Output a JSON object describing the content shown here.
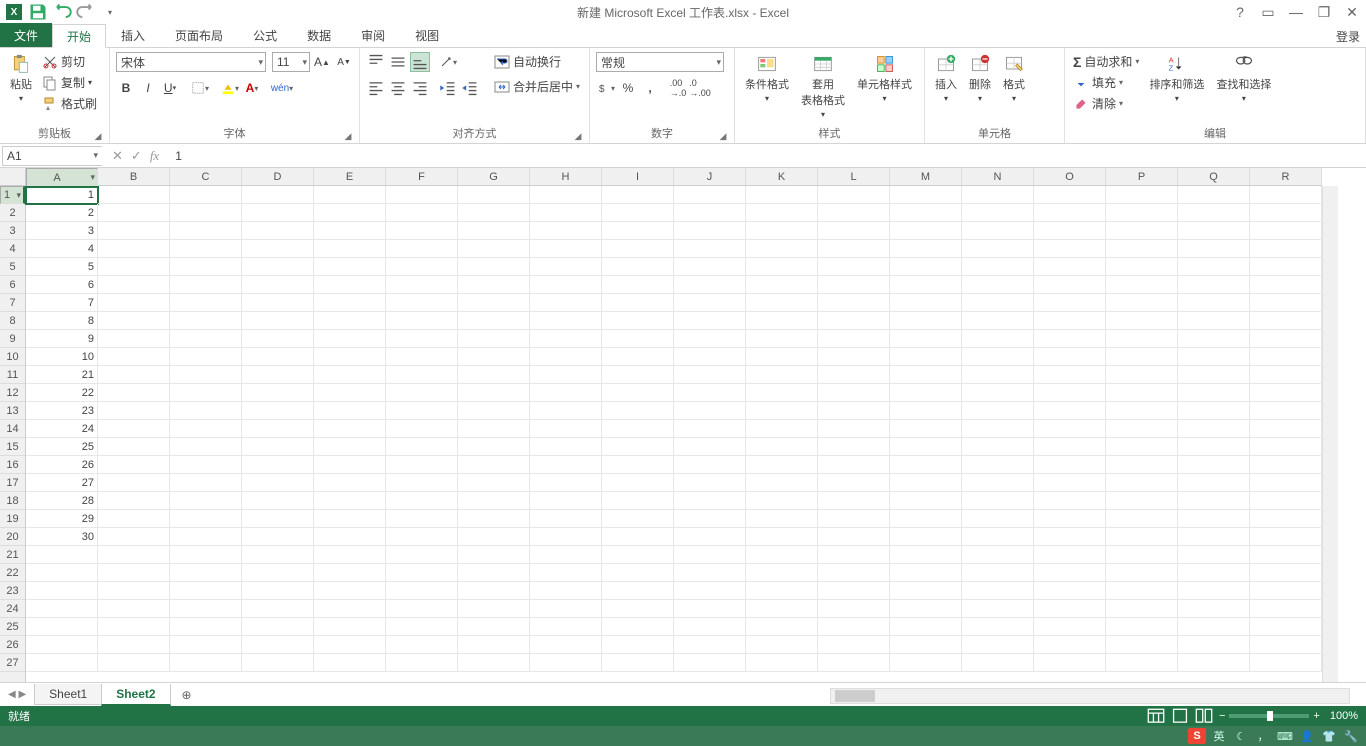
{
  "title": "新建 Microsoft Excel 工作表.xlsx - Excel",
  "login_label": "登录",
  "tabs": {
    "file": "文件",
    "home": "开始",
    "insert": "插入",
    "layout": "页面布局",
    "formulas": "公式",
    "data": "数据",
    "review": "审阅",
    "view": "视图"
  },
  "ribbon": {
    "clipboard": {
      "label": "剪贴板",
      "paste": "粘贴",
      "cut": "剪切",
      "copy": "复制",
      "format_painter": "格式刷"
    },
    "font": {
      "label": "字体",
      "name": "宋体",
      "size": "11"
    },
    "align": {
      "label": "对齐方式",
      "wrap": "自动换行",
      "merge": "合并后居中"
    },
    "number": {
      "label": "数字",
      "format": "常规"
    },
    "styles": {
      "label": "样式",
      "cond": "条件格式",
      "table": "套用\n表格格式",
      "cell": "单元格样式"
    },
    "cells": {
      "label": "单元格",
      "insert": "插入",
      "delete": "删除",
      "format": "格式"
    },
    "editing": {
      "label": "编辑",
      "sum": "自动求和",
      "fill": "填充",
      "clear": "清除",
      "sort": "排序和筛选",
      "find": "查找和选择"
    }
  },
  "namebox": "A1",
  "formula_value": "1",
  "columns": [
    "A",
    "B",
    "C",
    "D",
    "E",
    "F",
    "G",
    "H",
    "I",
    "J",
    "K",
    "L",
    "M",
    "N",
    "O",
    "P",
    "Q",
    "R"
  ],
  "rows": 27,
  "data_colA": [
    "1",
    "2",
    "3",
    "4",
    "5",
    "6",
    "7",
    "8",
    "9",
    "10",
    "21",
    "22",
    "23",
    "24",
    "25",
    "26",
    "27",
    "28",
    "29",
    "30"
  ],
  "active_cell": {
    "row": 0,
    "col": 0
  },
  "sheets": {
    "s1": "Sheet1",
    "s2": "Sheet2"
  },
  "status": {
    "ready": "就绪",
    "zoom": "100%"
  },
  "ime": "英"
}
